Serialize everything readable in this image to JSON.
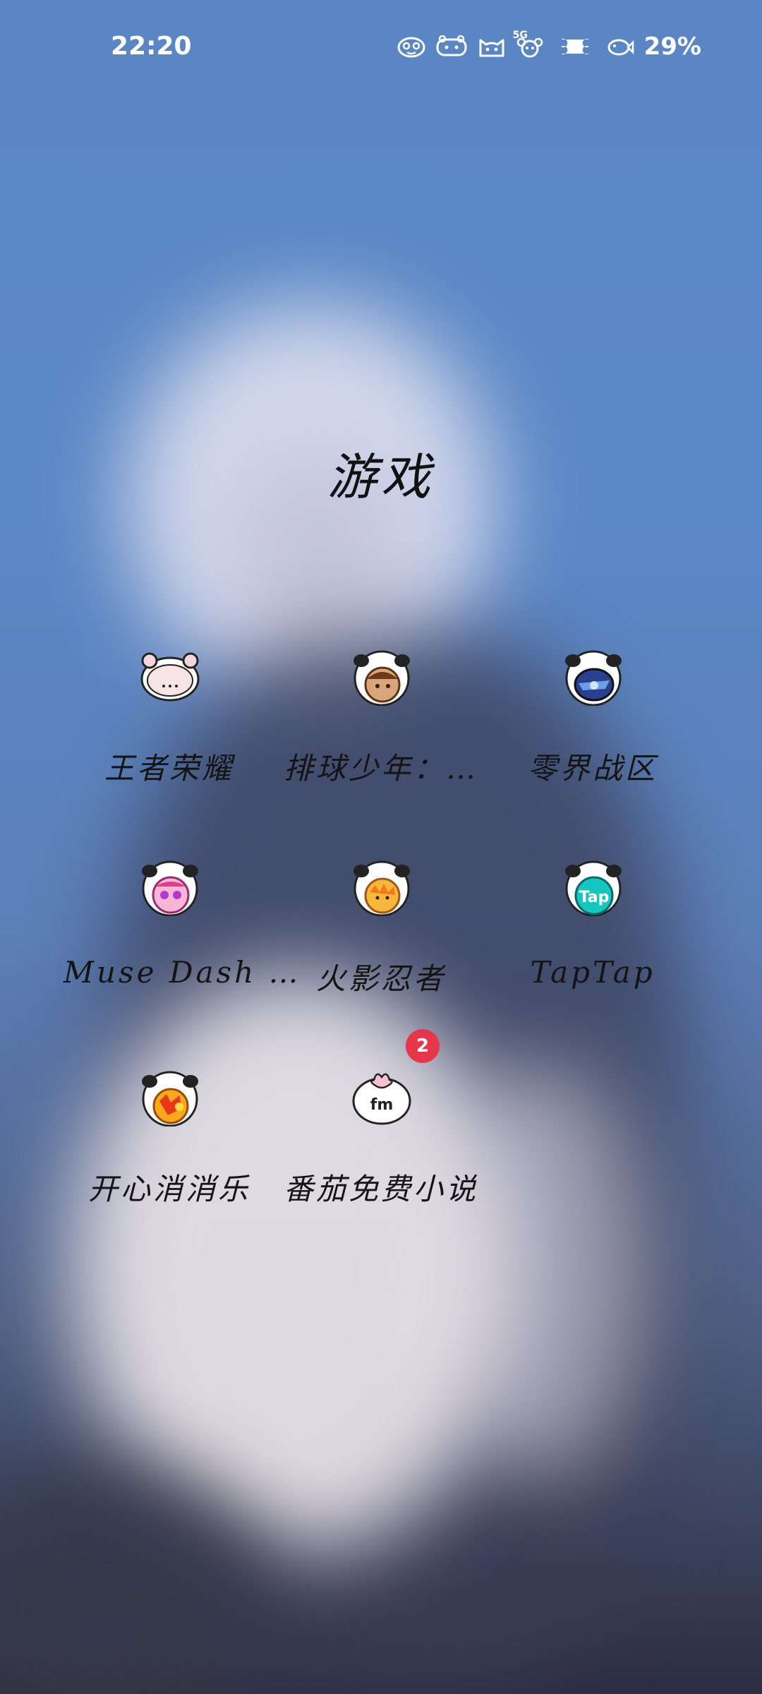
{
  "status_bar": {
    "time": "22:20",
    "network": "5G",
    "battery": "29%"
  },
  "folder": {
    "title": "游戏"
  },
  "apps": [
    {
      "label": "王者荣耀",
      "icon": "pig-sticker-icon"
    },
    {
      "label": "排球少年：…",
      "icon": "haikyu-puppy-sticker-icon"
    },
    {
      "label": "零界战区",
      "icon": "zero-zone-puppy-sticker-icon"
    },
    {
      "label": "Muse Dash …",
      "icon": "muse-dash-puppy-sticker-icon"
    },
    {
      "label": "火影忍者",
      "icon": "naruto-puppy-sticker-icon"
    },
    {
      "label": "TapTap",
      "icon": "taptap-puppy-sticker-icon"
    },
    {
      "label": "开心消消乐",
      "icon": "happy-match-puppy-sticker-icon"
    },
    {
      "label": "番茄免费小说",
      "icon": "fanqie-novel-fm-icon",
      "badge": "2"
    }
  ],
  "colors": {
    "wallpaper_top": "#5a87c4",
    "wallpaper_bottom": "#2c2d40",
    "badge": "#e5364c"
  }
}
